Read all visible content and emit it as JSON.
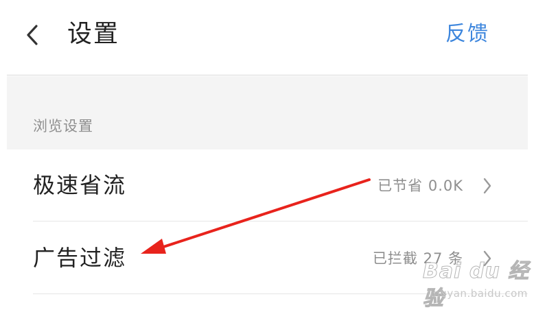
{
  "header": {
    "back_icon": "chevron-left-icon",
    "title": "设置",
    "feedback_label": "反馈",
    "accent_color": "#3d86dd"
  },
  "section": {
    "label": "浏览设置"
  },
  "rows": [
    {
      "label": "极速省流",
      "value": "已节省 0.0K",
      "icon": "chevron-right-icon"
    },
    {
      "label": "广告过滤",
      "value": "已拦截 27 条",
      "icon": "chevron-right-icon"
    }
  ],
  "annotation": {
    "type": "red-arrow",
    "color": "#e8231c",
    "points_to": "广告过滤"
  },
  "watermark": {
    "logo": "Bai du 经验",
    "url": "jingyan.baidu.com"
  }
}
